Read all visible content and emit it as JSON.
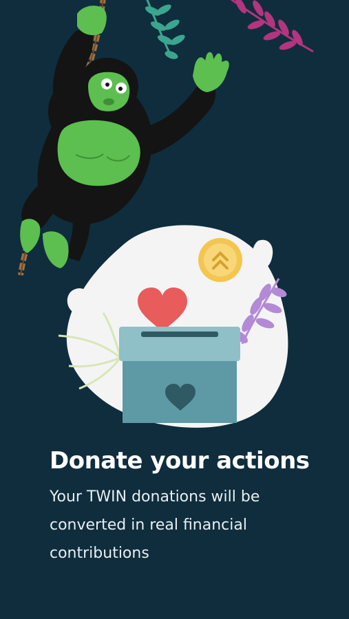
{
  "onboarding": {
    "title": "Donate your actions",
    "description": "Your TWIN donations will be converted in real financial contributions"
  },
  "icons": {
    "gorilla": "gorilla-on-rope-illustration",
    "donation": "donation-box-with-heart-illustration",
    "coin": "coin-icon",
    "heart": "heart-icon"
  },
  "colors": {
    "background": "#0f2d3d",
    "accent_green": "#5cbf4f",
    "heart": "#e85c5c",
    "coin": "#f3c64f",
    "box": "#5d9aa6"
  }
}
